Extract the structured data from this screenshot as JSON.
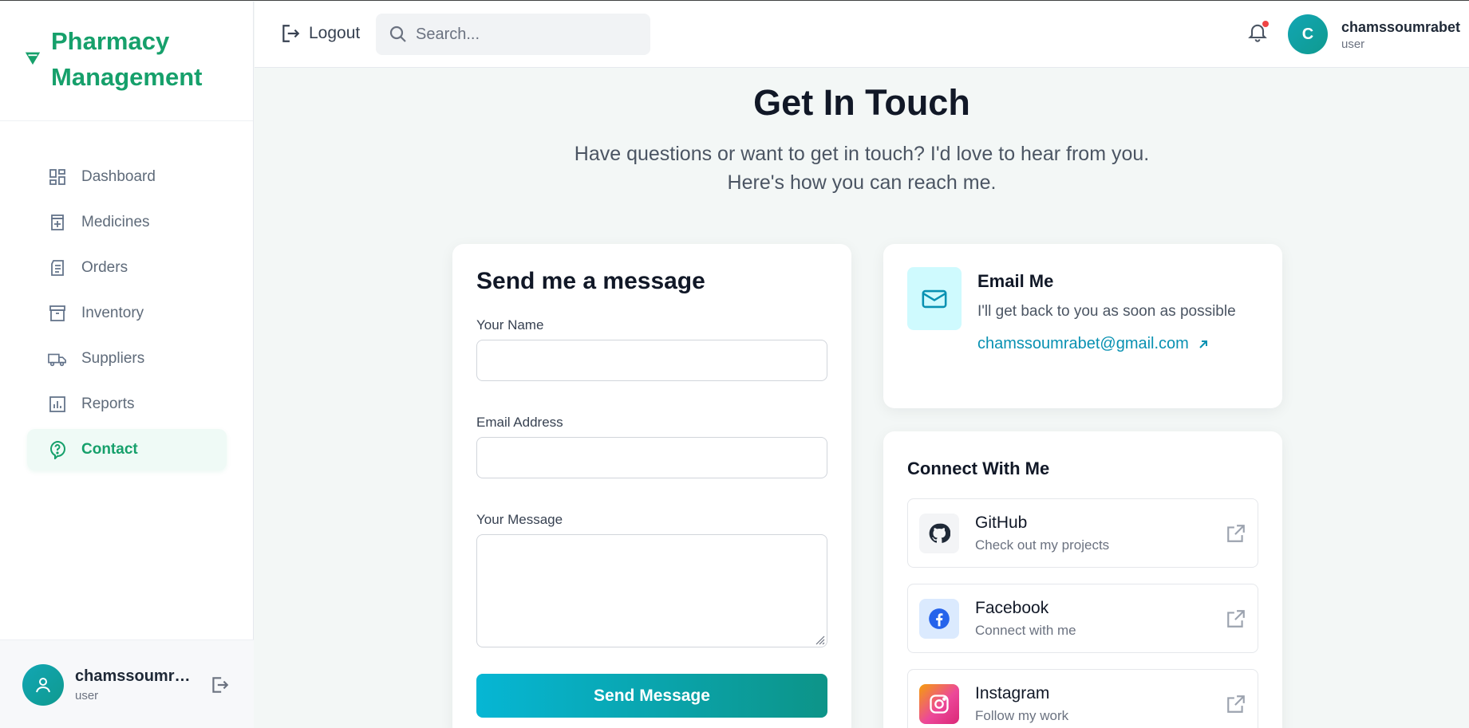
{
  "sidebar": {
    "brand": {
      "line1": "Pharmacy",
      "line2": "Management",
      "icon": "pill-triangle-icon"
    },
    "items": [
      {
        "label": "Dashboard",
        "icon": "dashboard-icon"
      },
      {
        "label": "Medicines",
        "icon": "medicine-icon"
      },
      {
        "label": "Orders",
        "icon": "orders-icon"
      },
      {
        "label": "Inventory",
        "icon": "inventory-icon"
      },
      {
        "label": "Suppliers",
        "icon": "truck-icon"
      },
      {
        "label": "Reports",
        "icon": "reports-icon"
      },
      {
        "label": "Contact",
        "icon": "help-icon",
        "active": true
      }
    ],
    "user": {
      "name": "chamssoumrabet",
      "role": "user"
    }
  },
  "header": {
    "logout_label": "Logout",
    "search_placeholder": "Search...",
    "avatar_initial": "C",
    "user_name": "chamssoumrabet",
    "user_role": "user"
  },
  "main": {
    "title": "Get In Touch",
    "subtitle_line1": "Have questions or want to get in touch? I'd love to hear from you.",
    "subtitle_line2": "Here's how you can reach me.",
    "form": {
      "title": "Send me a message",
      "name_label": "Your Name",
      "email_label": "Email Address",
      "message_label": "Your Message",
      "submit_label": "Send Message"
    },
    "email_card": {
      "title": "Email Me",
      "description": "I'll get back to you as soon as possible",
      "address": "chamssoumrabet@gmail.com"
    },
    "social": {
      "title": "Connect With Me",
      "items": [
        {
          "name": "GitHub",
          "description": "Check out my projects"
        },
        {
          "name": "Facebook",
          "description": "Connect with me"
        },
        {
          "name": "Instagram",
          "description": "Follow my work"
        }
      ]
    }
  },
  "colors": {
    "brand_green": "#16a06b",
    "teal_gradient_start": "#06b6d4",
    "teal_gradient_end": "#0d9488",
    "link_cyan": "#0891b2",
    "notification_dot": "#ef4444"
  }
}
